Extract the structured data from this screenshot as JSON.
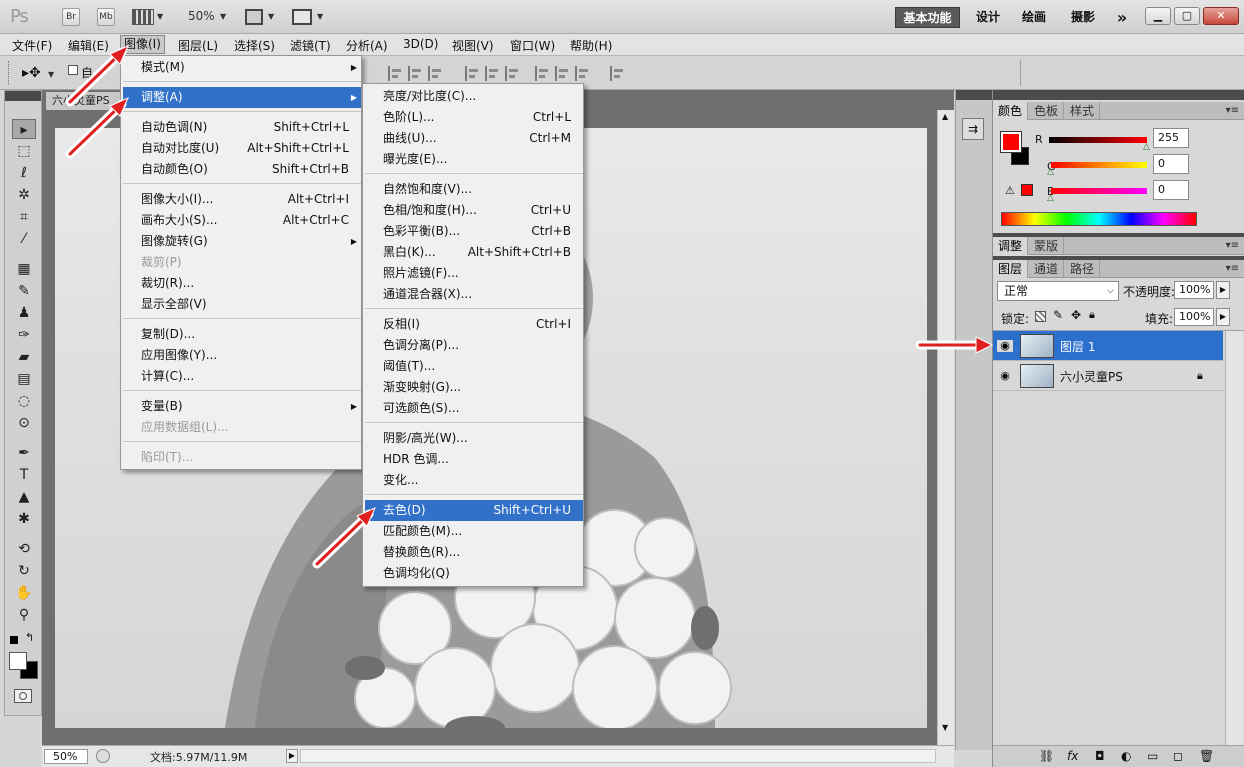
{
  "app": {
    "logo": "Ps",
    "bridge_btn": "Br",
    "minibridge_btn": "Mb",
    "zoom": "50%",
    "workspaces": [
      "基本功能",
      "设计",
      "绘画",
      "摄影"
    ],
    "more": "»"
  },
  "menubar": [
    "文件(F)",
    "编辑(E)",
    "图像(I)",
    "图层(L)",
    "选择(S)",
    "滤镜(T)",
    "分析(A)",
    "3D(D)",
    "视图(V)",
    "窗口(W)",
    "帮助(H)"
  ],
  "options": {
    "auto_select_label": "自"
  },
  "document": {
    "tab_title": "六小灵童PS",
    "zoom_field": "50%",
    "doc_info": "文档:5.97M/11.9M"
  },
  "image_menu": {
    "items": [
      {
        "label": "模式(M)",
        "shortcut": "",
        "submenu": true
      },
      {
        "label": "调整(A)",
        "shortcut": "",
        "submenu": true,
        "highlight": true
      },
      {
        "label": "自动色调(N)",
        "shortcut": "Shift+Ctrl+L"
      },
      {
        "label": "自动对比度(U)",
        "shortcut": "Alt+Shift+Ctrl+L"
      },
      {
        "label": "自动颜色(O)",
        "shortcut": "Shift+Ctrl+B"
      },
      {
        "label": "图像大小(I)...",
        "shortcut": "Alt+Ctrl+I"
      },
      {
        "label": "画布大小(S)...",
        "shortcut": "Alt+Ctrl+C"
      },
      {
        "label": "图像旋转(G)",
        "shortcut": "",
        "submenu": true
      },
      {
        "label": "裁剪(P)",
        "shortcut": "",
        "disabled": true
      },
      {
        "label": "裁切(R)...",
        "shortcut": ""
      },
      {
        "label": "显示全部(V)",
        "shortcut": ""
      },
      {
        "label": "复制(D)...",
        "shortcut": ""
      },
      {
        "label": "应用图像(Y)...",
        "shortcut": ""
      },
      {
        "label": "计算(C)...",
        "shortcut": ""
      },
      {
        "label": "变量(B)",
        "shortcut": "",
        "submenu": true
      },
      {
        "label": "应用数据组(L)...",
        "shortcut": "",
        "disabled": true
      },
      {
        "label": "陷印(T)...",
        "shortcut": "",
        "disabled": true
      }
    ]
  },
  "adjust_menu": {
    "items": [
      {
        "label": "亮度/对比度(C)...",
        "shortcut": ""
      },
      {
        "label": "色阶(L)...",
        "shortcut": "Ctrl+L"
      },
      {
        "label": "曲线(U)...",
        "shortcut": "Ctrl+M"
      },
      {
        "label": "曝光度(E)...",
        "shortcut": ""
      },
      {
        "label": "自然饱和度(V)...",
        "shortcut": ""
      },
      {
        "label": "色相/饱和度(H)...",
        "shortcut": "Ctrl+U"
      },
      {
        "label": "色彩平衡(B)...",
        "shortcut": "Ctrl+B"
      },
      {
        "label": "黑白(K)...",
        "shortcut": "Alt+Shift+Ctrl+B"
      },
      {
        "label": "照片滤镜(F)...",
        "shortcut": ""
      },
      {
        "label": "通道混合器(X)...",
        "shortcut": ""
      },
      {
        "label": "反相(I)",
        "shortcut": "Ctrl+I"
      },
      {
        "label": "色调分离(P)...",
        "shortcut": ""
      },
      {
        "label": "阈值(T)...",
        "shortcut": ""
      },
      {
        "label": "渐变映射(G)...",
        "shortcut": ""
      },
      {
        "label": "可选颜色(S)...",
        "shortcut": ""
      },
      {
        "label": "阴影/高光(W)...",
        "shortcut": ""
      },
      {
        "label": "HDR 色调...",
        "shortcut": ""
      },
      {
        "label": "变化...",
        "shortcut": ""
      },
      {
        "label": "去色(D)",
        "shortcut": "Shift+Ctrl+U",
        "highlight": true
      },
      {
        "label": "匹配颜色(M)...",
        "shortcut": ""
      },
      {
        "label": "替换颜色(R)...",
        "shortcut": ""
      },
      {
        "label": "色调均化(Q)",
        "shortcut": ""
      }
    ]
  },
  "color_panel": {
    "tabs": [
      "颜色",
      "色板",
      "样式"
    ],
    "r_label": "R",
    "g_label": "G",
    "b_label": "B",
    "r": "255",
    "g": "0",
    "b": "0",
    "fg_color": "#ff0000",
    "bg_color": "#000000"
  },
  "adjust_panel": {
    "tabs": [
      "调整",
      "蒙版"
    ]
  },
  "layers_panel": {
    "tabs": [
      "图层",
      "通道",
      "路径"
    ],
    "blend_mode": "正常",
    "opacity_label": "不透明度:",
    "opacity": "100%",
    "lock_label": "锁定:",
    "fill_label": "填充:",
    "fill": "100%",
    "layers": [
      {
        "name": "图层 1",
        "selected": true
      },
      {
        "name": "六小灵童PS",
        "locked": true
      }
    ]
  },
  "colors": {
    "highlight": "#3171c9",
    "layer_selected": "#2c6fcd",
    "arrow": "#e02020"
  }
}
